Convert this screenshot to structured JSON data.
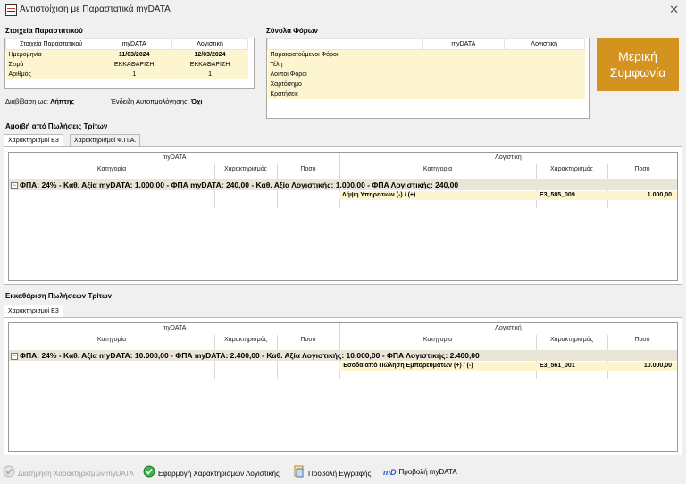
{
  "window": {
    "title": "Αντιστοίχιση με Παραστατικά myDATA"
  },
  "doc": {
    "section_title": "Στοιχεία Παραστατικού",
    "headers": [
      "Στοιχεία Παραστατικού",
      "myDATA",
      "Λογιστική"
    ],
    "rows": [
      {
        "label": "Ημερομηνία",
        "mydata": "11/03/2024",
        "logistiki": "12/03/2024"
      },
      {
        "label": "Σειρά",
        "mydata": "ΕΚΚΑΘΑΡΙΣΗ",
        "logistiki": "ΕΚΚΑΘΑΡΙΣΗ"
      },
      {
        "label": "Αριθμός",
        "mydata": "1",
        "logistiki": "1"
      }
    ],
    "transmission_label": "Διαβίβαση ως:",
    "transmission_value": "Λήπτης",
    "autofill_label": "Ένδειξη Αυτοπμολόγησης:",
    "autofill_value": "Όχι"
  },
  "taxes": {
    "section_title": "Σύνολα Φόρων",
    "headers": [
      "",
      "myDATA",
      "Λογιστική"
    ],
    "rows": [
      "Παρακρατούμενοι Φόροι",
      "Τέλη",
      "Λοιποι Φόροι",
      "Χαρτόσημο",
      "Κρατήσεις"
    ]
  },
  "status_button": {
    "line1": "Μερική",
    "line2": "Συμφωνία"
  },
  "fees": {
    "section_title": "Αμοιβή από Πωλήσεις Τρίτων",
    "tabs": [
      "Χαρακτηρισμοί Ε3",
      "Χαρακτηρισμοί Φ.Π.Α."
    ],
    "mydata_header": "myDATA",
    "logistiki_header": "Λογιστική",
    "cols": [
      "Κατηγορία",
      "Χαρακτηρισμός",
      "Ποσό",
      "Κατηγορία",
      "Χαρακτηρισμός",
      "Ποσό"
    ],
    "group_left": "ΦΠΑ: 24%  -  Καθ. Αξία myDATA: 1.000,00  -  ΦΠΑ myDATA: 240,00",
    "group_right": "-  Καθ. Αξία Λογιστικής: 1.000,00  -  ΦΠΑ Λογιστικής: 240,00",
    "detail": {
      "category": "Λήψη Υπηρεσιών (-) / (+)",
      "code": "E3_585_009",
      "amount": "1.000,00"
    }
  },
  "clearing": {
    "section_title": "Εκκαθάριση Πωλήσεων Τρίτων",
    "tabs": [
      "Χαρακτηρισμοί Ε3"
    ],
    "mydata_header": "myDATA",
    "logistiki_header": "Λογιστική",
    "cols": [
      "Κατηγορία",
      "Χαρακτηρισμός",
      "Ποσό",
      "Κατηγορία",
      "Χαρακτηρισμός",
      "Ποσό"
    ],
    "group_left": "ΦΠΑ: 24%  -  Καθ. Αξία myDATA: 10.000,00  -  ΦΠΑ myDATA: 2.400,00",
    "group_right": "-  Καθ. Αξία Λογιστικής: 10.000,00  -  ΦΠΑ Λογιστικής: 2.400,00",
    "detail": {
      "category": "Έσοδα από Πώληση Εμπορευμάτων (+) / (-)",
      "code": "E3_561_001",
      "amount": "10.000,00"
    }
  },
  "toolbar": {
    "keep_mydata": "Διατήρηση Χαρακτηρισμών myDATA",
    "apply_logistiki": "Εφαρμογή Χαρακτηρισμών Λογιστικής",
    "view_entry": "Προβολή Εγγραφής",
    "view_mydata": "Προβολή myDATA",
    "mydata_logo": "mD"
  }
}
